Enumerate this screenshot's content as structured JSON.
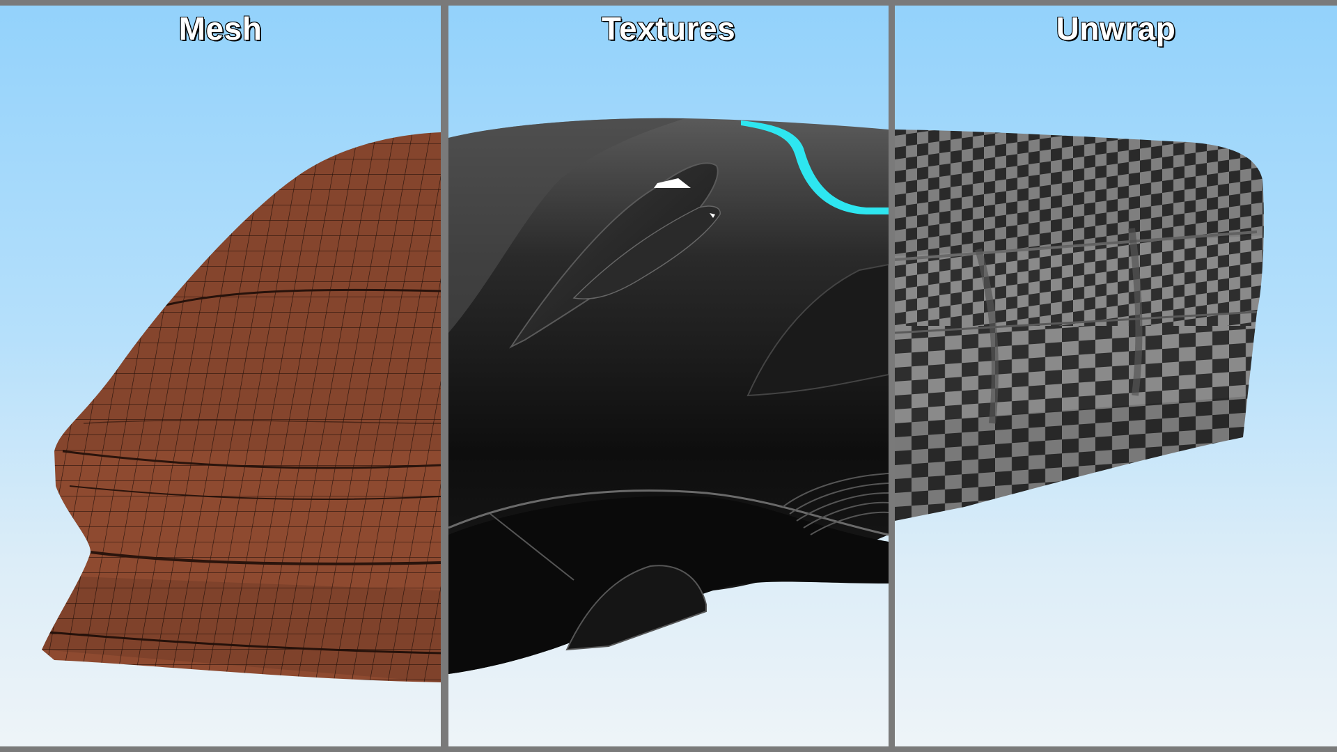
{
  "panels": [
    {
      "title": "Mesh"
    },
    {
      "title": "Textures"
    },
    {
      "title": "Unwrap"
    }
  ],
  "colors": {
    "frame": "#7a7a7a",
    "sky_top": "#93d2fb",
    "sky_bottom": "#eef4f8",
    "mesh_fill": "#8e4a30",
    "mesh_wire": "#2a140c",
    "body_dark": "#1a1a1a",
    "accent_cyan": "#2ee6f0",
    "checker_light": "#8a8a8a",
    "checker_dark": "#2e2e2e"
  }
}
